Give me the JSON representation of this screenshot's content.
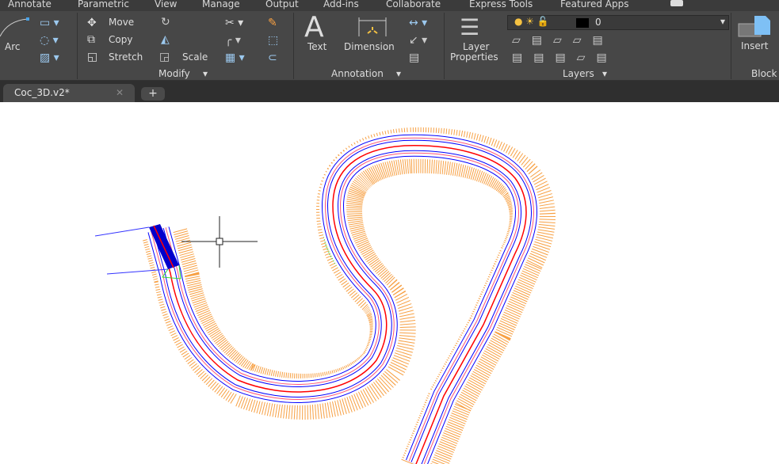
{
  "menu": [
    "Annotate",
    "Parametric",
    "View",
    "Manage",
    "Output",
    "Add-ins",
    "Collaborate",
    "Express Tools",
    "Featured Apps"
  ],
  "ribbon": {
    "draw": {
      "arc": "Arc"
    },
    "modify": {
      "title": "Modify",
      "move": "Move",
      "copy": "Copy",
      "stretch": "Stretch",
      "scale": "Scale"
    },
    "annotation": {
      "title": "Annotation",
      "text": "Text",
      "dimension": "Dimension"
    },
    "layers": {
      "title": "Layers",
      "layer_properties_1": "Layer",
      "layer_properties_2": "Properties",
      "current_layer": "0"
    },
    "block": {
      "insert": "Insert",
      "title": "Block"
    }
  },
  "tabs": {
    "active": "Coc_3D.v2*",
    "close": "✕",
    "new": "+"
  },
  "colors": {
    "road_edge": "#0000ff",
    "centerline": "#ff0000",
    "fill_slope": "#f7a043",
    "cut_slope": "#33dd33"
  }
}
